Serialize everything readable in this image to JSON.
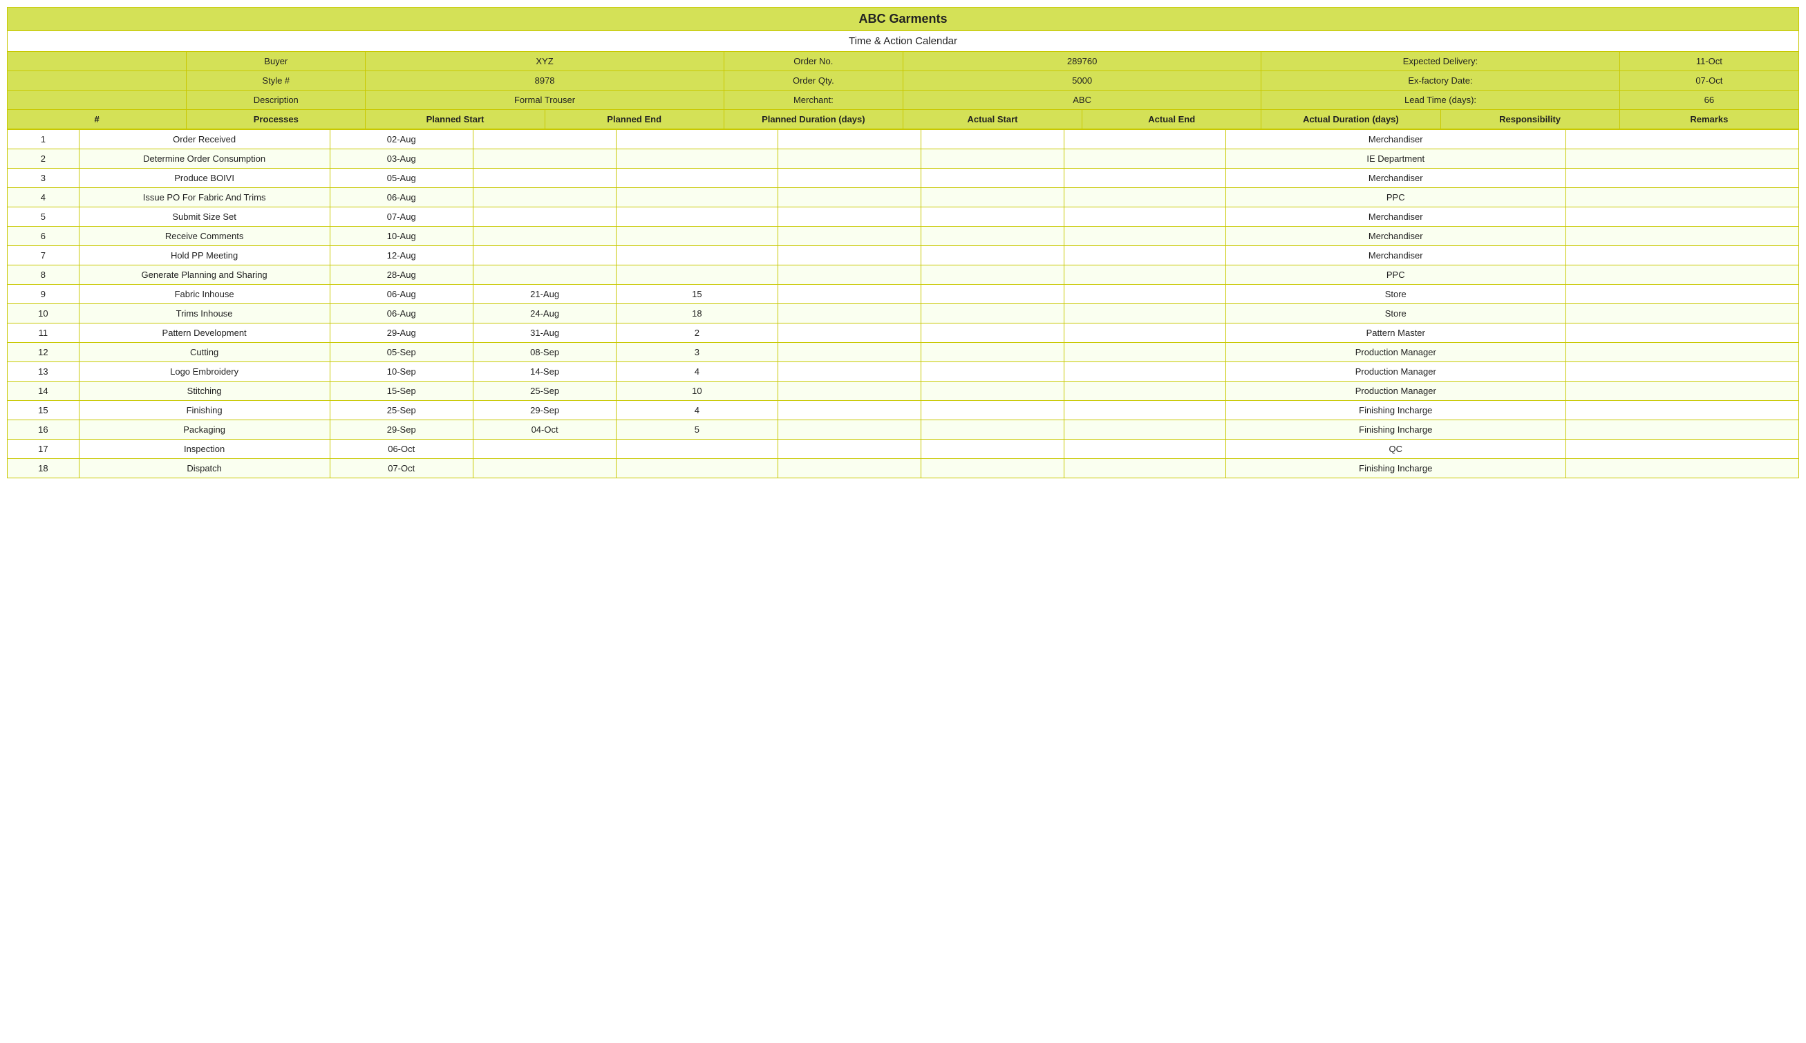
{
  "company": "ABC Garments",
  "document_title": "Time & Action Calendar",
  "info": {
    "buyer_label": "Buyer",
    "buyer_value": "XYZ",
    "order_no_label": "Order No.",
    "order_no_value": "289760",
    "expected_delivery_label": "Expected Delivery:",
    "expected_delivery_value": "11-Oct",
    "style_label": "Style #",
    "style_value": "8978",
    "order_qty_label": "Order Qty.",
    "order_qty_value": "5000",
    "ex_factory_label": "Ex-factory Date:",
    "ex_factory_value": "07-Oct",
    "description_label": "Description",
    "description_value": "Formal Trouser",
    "merchant_label": "Merchant:",
    "merchant_value": "ABC",
    "lead_time_label": "Lead Time (days):",
    "lead_time_value": "66"
  },
  "columns": {
    "num": "#",
    "processes": "Processes",
    "planned_start": "Planned Start",
    "planned_end": "Planned End",
    "planned_duration": "Planned Duration (days)",
    "actual_start": "Actual Start",
    "actual_end": "Actual End",
    "actual_duration": "Actual Duration (days)",
    "responsibility": "Responsibility",
    "remarks": "Remarks"
  },
  "rows": [
    {
      "num": "1",
      "process": "Order Received",
      "p_start": "02-Aug",
      "p_end": "",
      "p_dur": "",
      "a_start": "",
      "a_end": "",
      "a_dur": "",
      "resp": "Merchandiser",
      "remarks": ""
    },
    {
      "num": "2",
      "process": "Determine Order Consumption",
      "p_start": "03-Aug",
      "p_end": "",
      "p_dur": "",
      "a_start": "",
      "a_end": "",
      "a_dur": "",
      "resp": "IE Department",
      "remarks": ""
    },
    {
      "num": "3",
      "process": "Produce BOIVI",
      "p_start": "05-Aug",
      "p_end": "",
      "p_dur": "",
      "a_start": "",
      "a_end": "",
      "a_dur": "",
      "resp": "Merchandiser",
      "remarks": ""
    },
    {
      "num": "4",
      "process": "Issue PO For Fabric And Trims",
      "p_start": "06-Aug",
      "p_end": "",
      "p_dur": "",
      "a_start": "",
      "a_end": "",
      "a_dur": "",
      "resp": "PPC",
      "remarks": ""
    },
    {
      "num": "5",
      "process": "Submit Size Set",
      "p_start": "07-Aug",
      "p_end": "",
      "p_dur": "",
      "a_start": "",
      "a_end": "",
      "a_dur": "",
      "resp": "Merchandiser",
      "remarks": ""
    },
    {
      "num": "6",
      "process": "Receive Comments",
      "p_start": "10-Aug",
      "p_end": "",
      "p_dur": "",
      "a_start": "",
      "a_end": "",
      "a_dur": "",
      "resp": "Merchandiser",
      "remarks": ""
    },
    {
      "num": "7",
      "process": "Hold PP Meeting",
      "p_start": "12-Aug",
      "p_end": "",
      "p_dur": "",
      "a_start": "",
      "a_end": "",
      "a_dur": "",
      "resp": "Merchandiser",
      "remarks": ""
    },
    {
      "num": "8",
      "process": "Generate Planning and Sharing",
      "p_start": "28-Aug",
      "p_end": "",
      "p_dur": "",
      "a_start": "",
      "a_end": "",
      "a_dur": "",
      "resp": "PPC",
      "remarks": ""
    },
    {
      "num": "9",
      "process": "Fabric Inhouse",
      "p_start": "06-Aug",
      "p_end": "21-Aug",
      "p_dur": "15",
      "a_start": "",
      "a_end": "",
      "a_dur": "",
      "resp": "Store",
      "remarks": ""
    },
    {
      "num": "10",
      "process": "Trims Inhouse",
      "p_start": "06-Aug",
      "p_end": "24-Aug",
      "p_dur": "18",
      "a_start": "",
      "a_end": "",
      "a_dur": "",
      "resp": "Store",
      "remarks": ""
    },
    {
      "num": "11",
      "process": "Pattern Development",
      "p_start": "29-Aug",
      "p_end": "31-Aug",
      "p_dur": "2",
      "a_start": "",
      "a_end": "",
      "a_dur": "",
      "resp": "Pattern Master",
      "remarks": ""
    },
    {
      "num": "12",
      "process": "Cutting",
      "p_start": "05-Sep",
      "p_end": "08-Sep",
      "p_dur": "3",
      "a_start": "",
      "a_end": "",
      "a_dur": "",
      "resp": "Production Manager",
      "remarks": ""
    },
    {
      "num": "13",
      "process": "Logo Embroidery",
      "p_start": "10-Sep",
      "p_end": "14-Sep",
      "p_dur": "4",
      "a_start": "",
      "a_end": "",
      "a_dur": "",
      "resp": "Production Manager",
      "remarks": ""
    },
    {
      "num": "14",
      "process": "Stitching",
      "p_start": "15-Sep",
      "p_end": "25-Sep",
      "p_dur": "10",
      "a_start": "",
      "a_end": "",
      "a_dur": "",
      "resp": "Production Manager",
      "remarks": ""
    },
    {
      "num": "15",
      "process": "Finishing",
      "p_start": "25-Sep",
      "p_end": "29-Sep",
      "p_dur": "4",
      "a_start": "",
      "a_end": "",
      "a_dur": "",
      "resp": "Finishing Incharge",
      "remarks": ""
    },
    {
      "num": "16",
      "process": "Packaging",
      "p_start": "29-Sep",
      "p_end": "04-Oct",
      "p_dur": "5",
      "a_start": "",
      "a_end": "",
      "a_dur": "",
      "resp": "Finishing Incharge",
      "remarks": ""
    },
    {
      "num": "17",
      "process": "Inspection",
      "p_start": "06-Oct",
      "p_end": "",
      "p_dur": "",
      "a_start": "",
      "a_end": "",
      "a_dur": "",
      "resp": "QC",
      "remarks": ""
    },
    {
      "num": "18",
      "process": "Dispatch",
      "p_start": "07-Oct",
      "p_end": "",
      "p_dur": "",
      "a_start": "",
      "a_end": "",
      "a_dur": "",
      "resp": "Finishing Incharge",
      "remarks": ""
    }
  ]
}
